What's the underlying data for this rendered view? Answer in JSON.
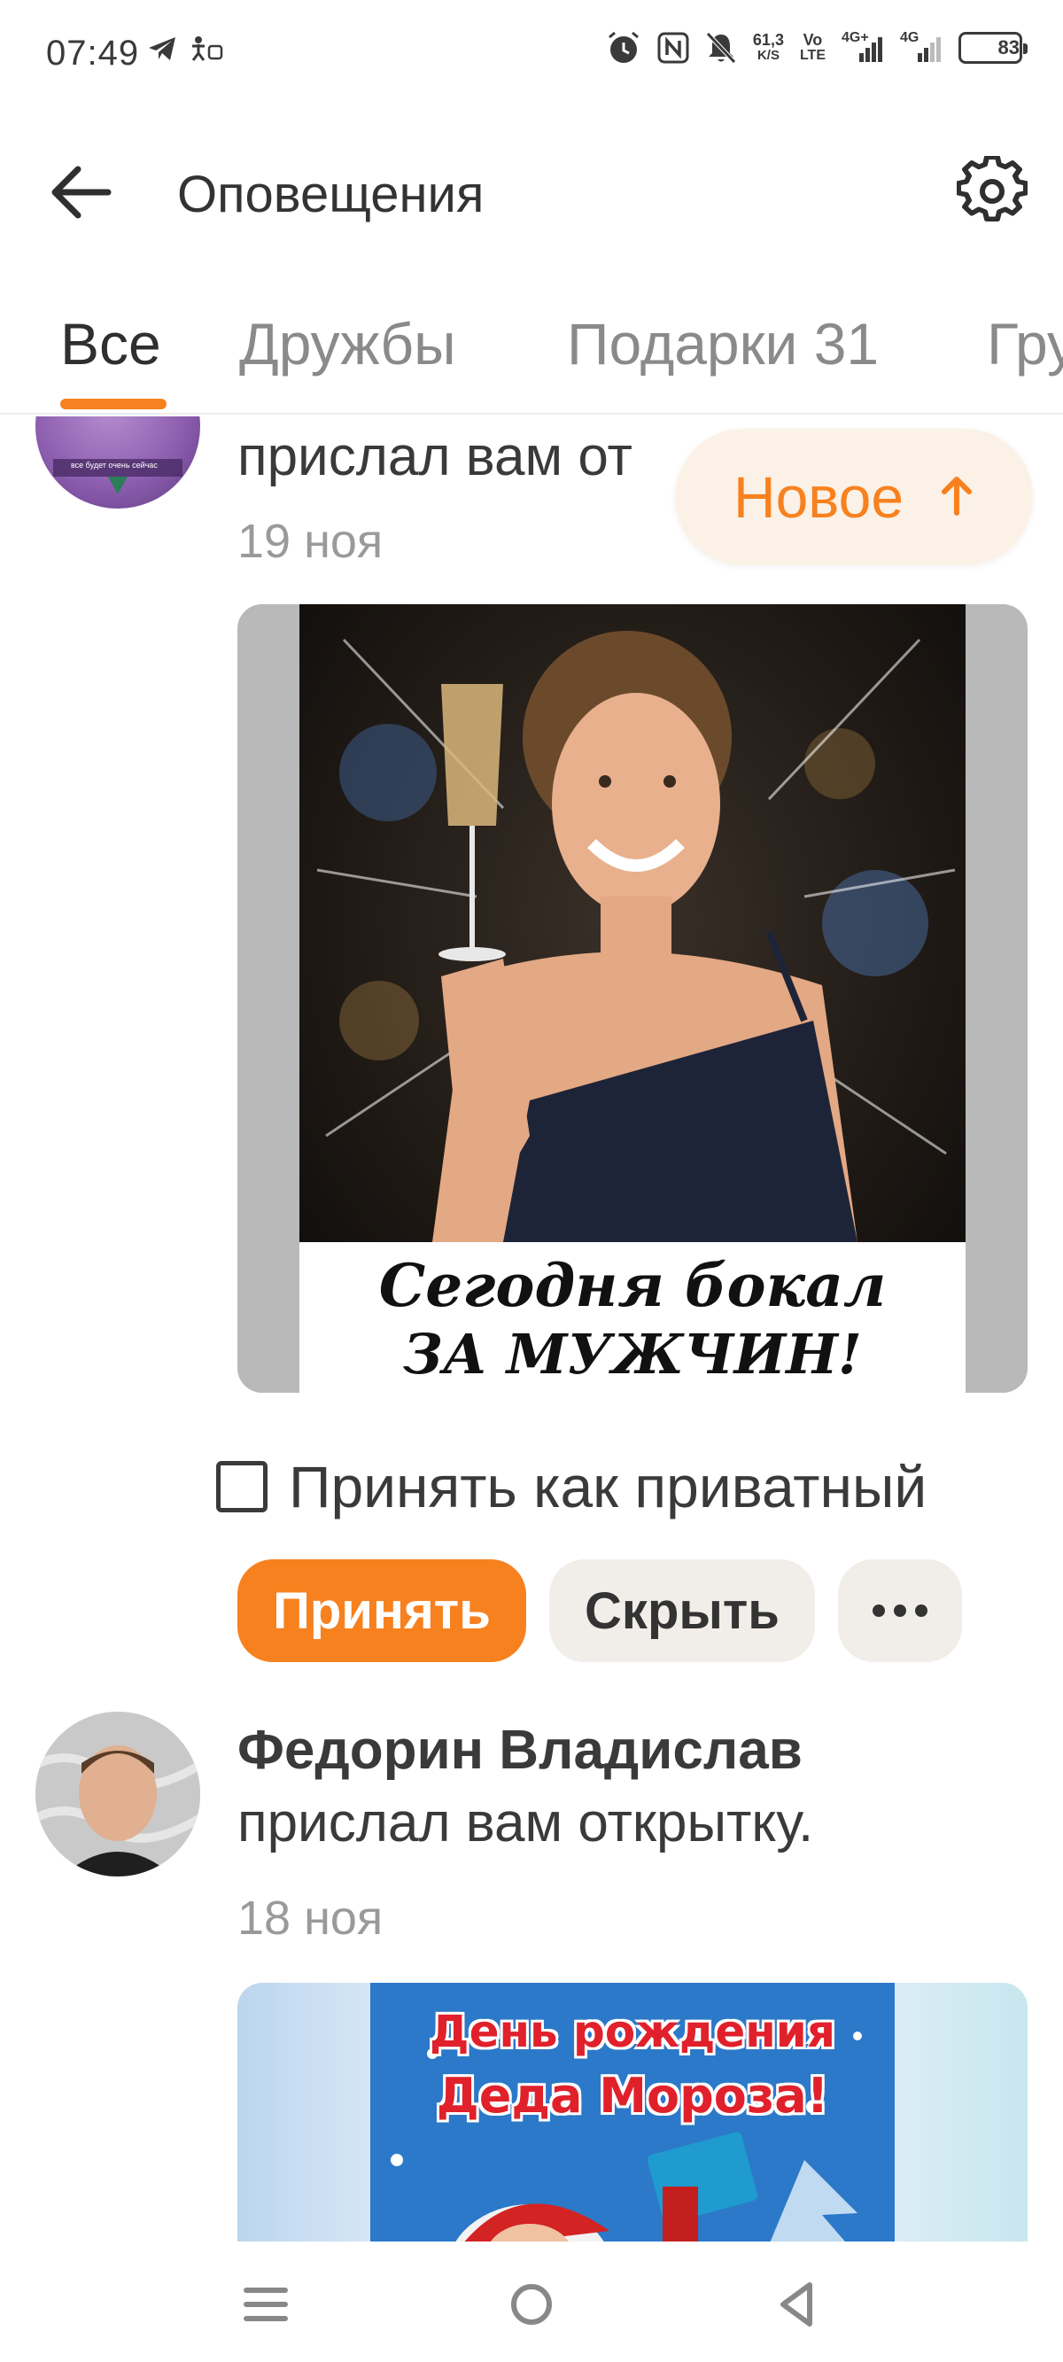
{
  "status_bar": {
    "time": "07:49",
    "net_speed": "61,3",
    "net_unit": "K/S",
    "volte_top": "Vo",
    "volte_bottom": "LTE",
    "sig1_label": "4G+",
    "sig2_label": "4G",
    "battery_level": "83"
  },
  "header": {
    "title": "Оповещения"
  },
  "tabs": [
    {
      "label": "Все",
      "active": true
    },
    {
      "label": "Дружбы",
      "active": false
    },
    {
      "label": "Подарки 31",
      "active": false
    },
    {
      "label": "Гру",
      "active": false
    }
  ],
  "new_button": {
    "label": "Новое",
    "arrow": "↑"
  },
  "notifications": [
    {
      "action_text": "прислал вам от",
      "date": "19 ноя",
      "card_text_line1": "Сегодня бокал",
      "card_text_line2": "ЗА МУЖЧИН!",
      "avatar_caption": "все будет очень сейчас"
    },
    {
      "name": "Федорин Владислав",
      "action_text": "прислал вам открытку.",
      "date": "18 ноя",
      "card_text_line1": "День рождения",
      "card_text_line2": "Деда Мороза!"
    }
  ],
  "private_checkbox": {
    "label": "Принять как приватный",
    "checked": false
  },
  "actions": {
    "accept": "Принять",
    "hide": "Скрыть",
    "more": "•••"
  },
  "colors": {
    "accent": "#f7811f",
    "pill_bg": "#fbf1e6",
    "button_bg": "#f1eeea"
  }
}
